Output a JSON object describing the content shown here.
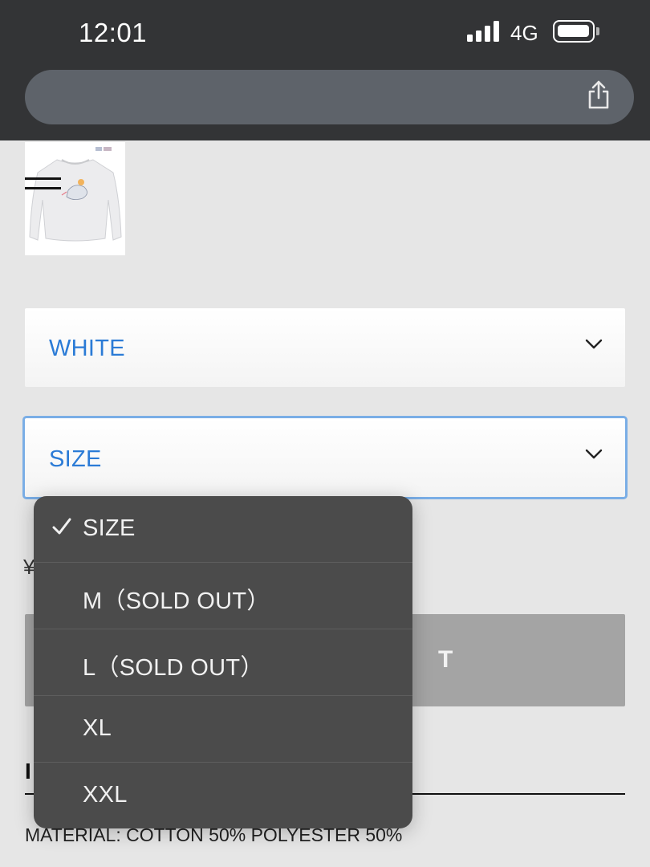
{
  "status_bar": {
    "time": "12:01",
    "network": "4G"
  },
  "icons": {
    "signal": "signal-bars-icon",
    "battery": "battery-icon",
    "share": "share-icon",
    "menu": "hamburger-menu-icon",
    "chevron": "chevron-down-icon",
    "check": "checkmark-icon"
  },
  "colors": {
    "accent": "#2b7bd6",
    "focus_border": "#7aaee6",
    "dropdown_bg": "#4b4b4b"
  },
  "product": {
    "color_select": {
      "value": "WHITE"
    },
    "size_select": {
      "value": "SIZE"
    },
    "price_fragment": "¥",
    "cart_button_fragment": "T",
    "section_fragment": "I",
    "material": "MATERIAL: COTTON 50% POLYESTER 50%"
  },
  "size_dropdown": {
    "selected_index": 0,
    "options": [
      {
        "label": "SIZE"
      },
      {
        "label": "M（SOLD OUT）"
      },
      {
        "label": "L（SOLD OUT）"
      },
      {
        "label": "XL"
      },
      {
        "label": "XXL"
      }
    ]
  }
}
